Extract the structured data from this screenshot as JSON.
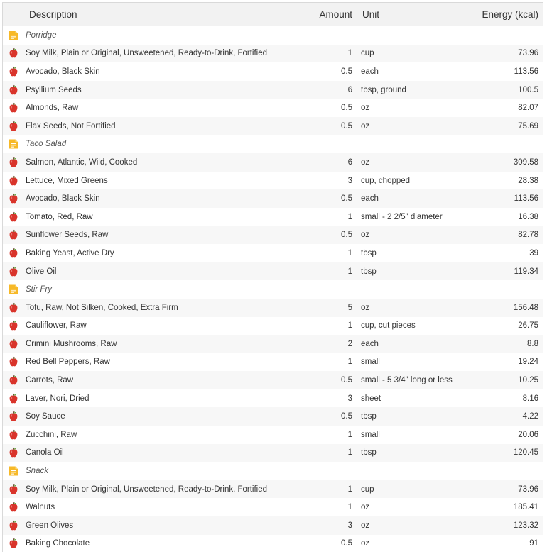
{
  "columns": {
    "description": "Description",
    "amount": "Amount",
    "unit": "Unit",
    "energy": "Energy (kcal)"
  },
  "rows": [
    {
      "type": "group",
      "name": "Porridge"
    },
    {
      "type": "food",
      "name": "Soy Milk, Plain or Original, Unsweetened, Ready-to-Drink, Fortified",
      "amount": "1",
      "unit": "cup",
      "energy": "73.96"
    },
    {
      "type": "food",
      "name": "Avocado, Black Skin",
      "amount": "0.5",
      "unit": "each",
      "energy": "113.56"
    },
    {
      "type": "food",
      "name": "Psyllium Seeds",
      "amount": "6",
      "unit": "tbsp, ground",
      "energy": "100.5"
    },
    {
      "type": "food",
      "name": "Almonds, Raw",
      "amount": "0.5",
      "unit": "oz",
      "energy": "82.07"
    },
    {
      "type": "food",
      "name": "Flax Seeds, Not Fortified",
      "amount": "0.5",
      "unit": "oz",
      "energy": "75.69"
    },
    {
      "type": "group",
      "name": "Taco Salad"
    },
    {
      "type": "food",
      "name": "Salmon, Atlantic, Wild, Cooked",
      "amount": "6",
      "unit": "oz",
      "energy": "309.58"
    },
    {
      "type": "food",
      "name": "Lettuce, Mixed Greens",
      "amount": "3",
      "unit": "cup, chopped",
      "energy": "28.38"
    },
    {
      "type": "food",
      "name": "Avocado, Black Skin",
      "amount": "0.5",
      "unit": "each",
      "energy": "113.56"
    },
    {
      "type": "food",
      "name": "Tomato, Red, Raw",
      "amount": "1",
      "unit": "small - 2 2/5\" diameter",
      "energy": "16.38"
    },
    {
      "type": "food",
      "name": "Sunflower Seeds, Raw",
      "amount": "0.5",
      "unit": "oz",
      "energy": "82.78"
    },
    {
      "type": "food",
      "name": "Baking Yeast, Active Dry",
      "amount": "1",
      "unit": "tbsp",
      "energy": "39"
    },
    {
      "type": "food",
      "name": "Olive Oil",
      "amount": "1",
      "unit": "tbsp",
      "energy": "119.34"
    },
    {
      "type": "group",
      "name": "Stir Fry"
    },
    {
      "type": "food",
      "name": "Tofu, Raw, Not Silken, Cooked, Extra Firm",
      "amount": "5",
      "unit": "oz",
      "energy": "156.48"
    },
    {
      "type": "food",
      "name": "Cauliflower, Raw",
      "amount": "1",
      "unit": "cup, cut pieces",
      "energy": "26.75"
    },
    {
      "type": "food",
      "name": "Crimini Mushrooms, Raw",
      "amount": "2",
      "unit": "each",
      "energy": "8.8"
    },
    {
      "type": "food",
      "name": "Red Bell Peppers, Raw",
      "amount": "1",
      "unit": "small",
      "energy": "19.24"
    },
    {
      "type": "food",
      "name": "Carrots, Raw",
      "amount": "0.5",
      "unit": "small - 5 3/4\" long or less",
      "energy": "10.25"
    },
    {
      "type": "food",
      "name": "Laver, Nori, Dried",
      "amount": "3",
      "unit": "sheet",
      "energy": "8.16"
    },
    {
      "type": "food",
      "name": "Soy Sauce",
      "amount": "0.5",
      "unit": "tbsp",
      "energy": "4.22"
    },
    {
      "type": "food",
      "name": "Zucchini, Raw",
      "amount": "1",
      "unit": "small",
      "energy": "20.06"
    },
    {
      "type": "food",
      "name": "Canola Oil",
      "amount": "1",
      "unit": "tbsp",
      "energy": "120.45"
    },
    {
      "type": "group",
      "name": "Snack"
    },
    {
      "type": "food",
      "name": "Soy Milk, Plain or Original, Unsweetened, Ready-to-Drink, Fortified",
      "amount": "1",
      "unit": "cup",
      "energy": "73.96"
    },
    {
      "type": "food",
      "name": "Walnuts",
      "amount": "1",
      "unit": "oz",
      "energy": "185.41"
    },
    {
      "type": "food",
      "name": "Green Olives",
      "amount": "3",
      "unit": "oz",
      "energy": "123.32"
    },
    {
      "type": "food",
      "name": "Baking Chocolate",
      "amount": "0.5",
      "unit": "oz",
      "energy": "91"
    }
  ],
  "icons": {
    "food": "apple-icon",
    "group": "note-icon"
  },
  "colors": {
    "apple_red": "#d9342b",
    "note_yellow": "#f7b928",
    "row_stripe": "#f7f7f7",
    "header_bg": "#f2f2f2"
  }
}
